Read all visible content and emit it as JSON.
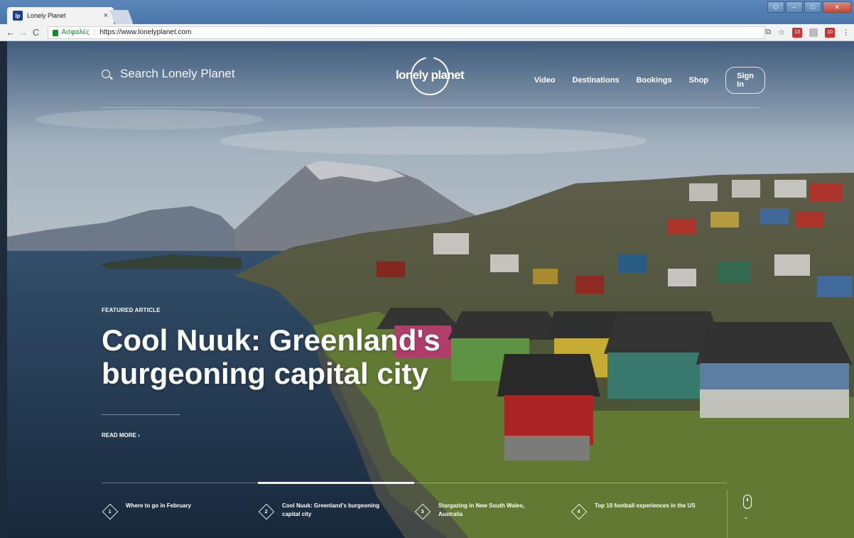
{
  "browser": {
    "tab_title": "Lonely Planet",
    "tab_favicon": "lp",
    "tab_close": "×",
    "secure_label": "Ασφαλές",
    "url": "https://www.lonelyplanet.com",
    "extension_badge_1": "13",
    "extension_badge_2": "10"
  },
  "header": {
    "search_placeholder": "Search Lonely Planet",
    "logo_text": "lonely planet",
    "nav": [
      "Video",
      "Destinations",
      "Bookings",
      "Shop"
    ],
    "signin_label": "Sign In"
  },
  "featured": {
    "kicker": "FEATURED ARTICLE",
    "headline": "Cool Nuuk: Greenland's burgeoning capital city",
    "read_more": "READ MORE"
  },
  "stories": [
    {
      "num": "1",
      "title": "Where to go in February"
    },
    {
      "num": "2",
      "title": "Cool Nuuk: Greenland's burgeoning capital city"
    },
    {
      "num": "3",
      "title": "Stargazing in New South Wales, Australia"
    },
    {
      "num": "4",
      "title": "Top 10 football experiences in the US"
    }
  ],
  "colors": {
    "accent_active_bar": "#ffffff",
    "secure_green": "#1a8a2e"
  }
}
